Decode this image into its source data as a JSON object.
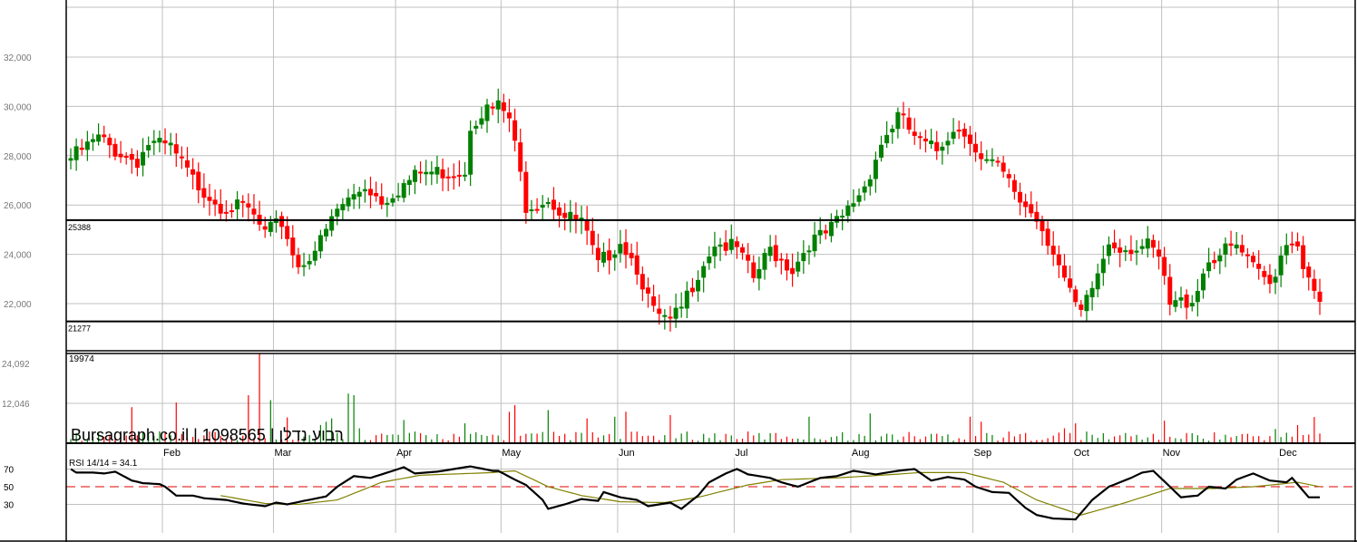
{
  "chart_data": {
    "type": "candlestick",
    "watermark": "Bursagraph.co.il | 1098565 | רבוע נדלן",
    "candle_count": 226,
    "price_axis": {
      "ticks": [
        22000,
        24000,
        26000,
        28000,
        30000,
        32000
      ],
      "tick_labels": [
        "22,000",
        "24,000",
        "26,000",
        "28,000",
        "30,000",
        "32,000"
      ],
      "ylim": [
        20000,
        34300
      ]
    },
    "support_resistance": [
      {
        "value": 25388,
        "label": "25388"
      },
      {
        "value": 21277,
        "label": "21277"
      }
    ],
    "months": [
      "Feb",
      "Mar",
      "Apr",
      "May",
      "Jun",
      "Jul",
      "Aug",
      "Sep",
      "Oct",
      "Nov",
      "Dec"
    ],
    "month_start_index": [
      17,
      37,
      59,
      78,
      99,
      120,
      141,
      163,
      181,
      197,
      218
    ],
    "close_anchors": [
      [
        0,
        27900
      ],
      [
        5,
        28700
      ],
      [
        8,
        28200
      ],
      [
        12,
        27800
      ],
      [
        14,
        28500
      ],
      [
        18,
        28300
      ],
      [
        22,
        27000
      ],
      [
        27,
        26000
      ],
      [
        32,
        25800
      ],
      [
        35,
        24800
      ],
      [
        38,
        25300
      ],
      [
        41,
        23500
      ],
      [
        45,
        24500
      ],
      [
        48,
        25800
      ],
      [
        53,
        26800
      ],
      [
        56,
        26200
      ],
      [
        63,
        27300
      ],
      [
        71,
        27400
      ],
      [
        72,
        29300
      ],
      [
        74,
        29800
      ],
      [
        77,
        30000
      ],
      [
        79,
        29500
      ],
      [
        81,
        27200
      ],
      [
        82,
        26000
      ],
      [
        86,
        26300
      ],
      [
        89,
        25500
      ],
      [
        92,
        25300
      ],
      [
        95,
        23500
      ],
      [
        99,
        24600
      ],
      [
        102,
        23500
      ],
      [
        105,
        21600
      ],
      [
        108,
        21200
      ],
      [
        110,
        21800
      ],
      [
        113,
        23300
      ],
      [
        116,
        24500
      ],
      [
        120,
        24200
      ],
      [
        123,
        23000
      ],
      [
        126,
        24200
      ],
      [
        130,
        23400
      ],
      [
        133,
        24500
      ],
      [
        136,
        24800
      ],
      [
        139,
        25500
      ],
      [
        143,
        26800
      ],
      [
        146,
        28500
      ],
      [
        149,
        29600
      ],
      [
        153,
        28500
      ],
      [
        156,
        28200
      ],
      [
        159,
        29200
      ],
      [
        162,
        28800
      ],
      [
        164,
        27800
      ],
      [
        167,
        27500
      ],
      [
        171,
        26200
      ],
      [
        174,
        25500
      ],
      [
        177,
        24200
      ],
      [
        180,
        22300
      ],
      [
        182,
        21500
      ],
      [
        185,
        23200
      ],
      [
        187,
        24500
      ],
      [
        190,
        24300
      ],
      [
        194,
        24300
      ],
      [
        196,
        23800
      ],
      [
        198,
        21900
      ],
      [
        202,
        22200
      ],
      [
        205,
        23800
      ],
      [
        210,
        24300
      ],
      [
        213,
        23400
      ],
      [
        216,
        22800
      ],
      [
        219,
        24600
      ],
      [
        221,
        24500
      ],
      [
        223,
        22800
      ],
      [
        225,
        21900
      ]
    ],
    "volume_axis": {
      "ticks": [
        12046,
        24092
      ],
      "tick_labels": [
        "12,046",
        "24,092"
      ],
      "last_label": "19974"
    },
    "volume_baseline": 1800,
    "volume_spikes": [
      [
        11,
        10900
      ],
      [
        19,
        12300
      ],
      [
        32,
        14500
      ],
      [
        34,
        27000
      ],
      [
        36,
        13000
      ],
      [
        39,
        7800
      ],
      [
        45,
        5500
      ],
      [
        46,
        6500
      ],
      [
        47,
        7500
      ],
      [
        50,
        15000
      ],
      [
        51,
        14500
      ],
      [
        52,
        4500
      ],
      [
        60,
        7000
      ],
      [
        71,
        6000
      ],
      [
        79,
        9500
      ],
      [
        80,
        11500
      ],
      [
        86,
        10000
      ],
      [
        93,
        7500
      ],
      [
        98,
        8000
      ],
      [
        100,
        9500
      ],
      [
        108,
        8500
      ],
      [
        133,
        8000
      ],
      [
        144,
        9000
      ],
      [
        162,
        8000
      ],
      [
        164,
        6500
      ],
      [
        179,
        4500
      ],
      [
        181,
        6000
      ],
      [
        197,
        6800
      ],
      [
        217,
        4300
      ],
      [
        221,
        5500
      ],
      [
        224,
        7900
      ]
    ],
    "rsi": {
      "label": "RSI 14/14 = 34.1",
      "ticks": [
        30,
        50,
        70
      ],
      "tick_labels": [
        "30",
        "50",
        "70"
      ],
      "ref_level": 50,
      "anchors": [
        [
          0,
          70
        ],
        [
          1,
          66
        ],
        [
          4,
          66
        ],
        [
          6,
          65
        ],
        [
          8,
          67
        ],
        [
          11,
          57
        ],
        [
          13,
          54
        ],
        [
          16,
          53
        ],
        [
          17,
          50
        ],
        [
          19,
          40
        ],
        [
          22,
          40
        ],
        [
          24,
          37
        ],
        [
          28,
          35
        ],
        [
          31,
          31
        ],
        [
          35,
          28
        ],
        [
          37,
          32
        ],
        [
          39,
          30
        ],
        [
          42,
          34
        ],
        [
          46,
          39
        ],
        [
          48,
          50
        ],
        [
          51,
          62
        ],
        [
          54,
          60
        ],
        [
          58,
          68
        ],
        [
          60,
          72
        ],
        [
          62,
          65
        ],
        [
          66,
          67
        ],
        [
          69,
          70
        ],
        [
          72,
          73
        ],
        [
          76,
          68
        ],
        [
          77,
          68
        ],
        [
          80,
          58
        ],
        [
          82,
          52
        ],
        [
          85,
          35
        ],
        [
          86,
          25
        ],
        [
          89,
          30
        ],
        [
          92,
          36
        ],
        [
          95,
          34
        ],
        [
          96,
          44
        ],
        [
          99,
          38
        ],
        [
          102,
          35
        ],
        [
          104,
          28
        ],
        [
          108,
          32
        ],
        [
          110,
          25
        ],
        [
          113,
          40
        ],
        [
          115,
          55
        ],
        [
          118,
          65
        ],
        [
          120,
          70
        ],
        [
          122,
          64
        ],
        [
          126,
          60
        ],
        [
          128,
          55
        ],
        [
          131,
          50
        ],
        [
          135,
          60
        ],
        [
          138,
          62
        ],
        [
          141,
          68
        ],
        [
          145,
          64
        ],
        [
          149,
          68
        ],
        [
          152,
          70
        ],
        [
          155,
          57
        ],
        [
          158,
          61
        ],
        [
          161,
          58
        ],
        [
          163,
          50
        ],
        [
          166,
          44
        ],
        [
          169,
          43
        ],
        [
          172,
          26
        ],
        [
          174,
          18
        ],
        [
          177,
          14
        ],
        [
          181,
          13
        ],
        [
          184,
          35
        ],
        [
          187,
          50
        ],
        [
          191,
          60
        ],
        [
          193,
          66
        ],
        [
          195,
          68
        ],
        [
          198,
          50
        ],
        [
          200,
          38
        ],
        [
          203,
          40
        ],
        [
          205,
          50
        ],
        [
          208,
          48
        ],
        [
          210,
          58
        ],
        [
          213,
          65
        ],
        [
          216,
          57
        ],
        [
          219,
          55
        ],
        [
          220,
          60
        ],
        [
          223,
          38
        ],
        [
          225,
          38
        ]
      ],
      "signal_anchors": [
        [
          27,
          40
        ],
        [
          35,
          31
        ],
        [
          41,
          30
        ],
        [
          48,
          35
        ],
        [
          56,
          55
        ],
        [
          63,
          63
        ],
        [
          76,
          66
        ],
        [
          80,
          68
        ],
        [
          86,
          50
        ],
        [
          92,
          40
        ],
        [
          99,
          33
        ],
        [
          107,
          32
        ],
        [
          113,
          38
        ],
        [
          122,
          52
        ],
        [
          128,
          58
        ],
        [
          138,
          60
        ],
        [
          146,
          63
        ],
        [
          153,
          66
        ],
        [
          161,
          66
        ],
        [
          168,
          55
        ],
        [
          174,
          35
        ],
        [
          182,
          18
        ],
        [
          190,
          32
        ],
        [
          198,
          48
        ],
        [
          206,
          48
        ],
        [
          213,
          50
        ],
        [
          221,
          55
        ],
        [
          225,
          50
        ]
      ]
    }
  }
}
